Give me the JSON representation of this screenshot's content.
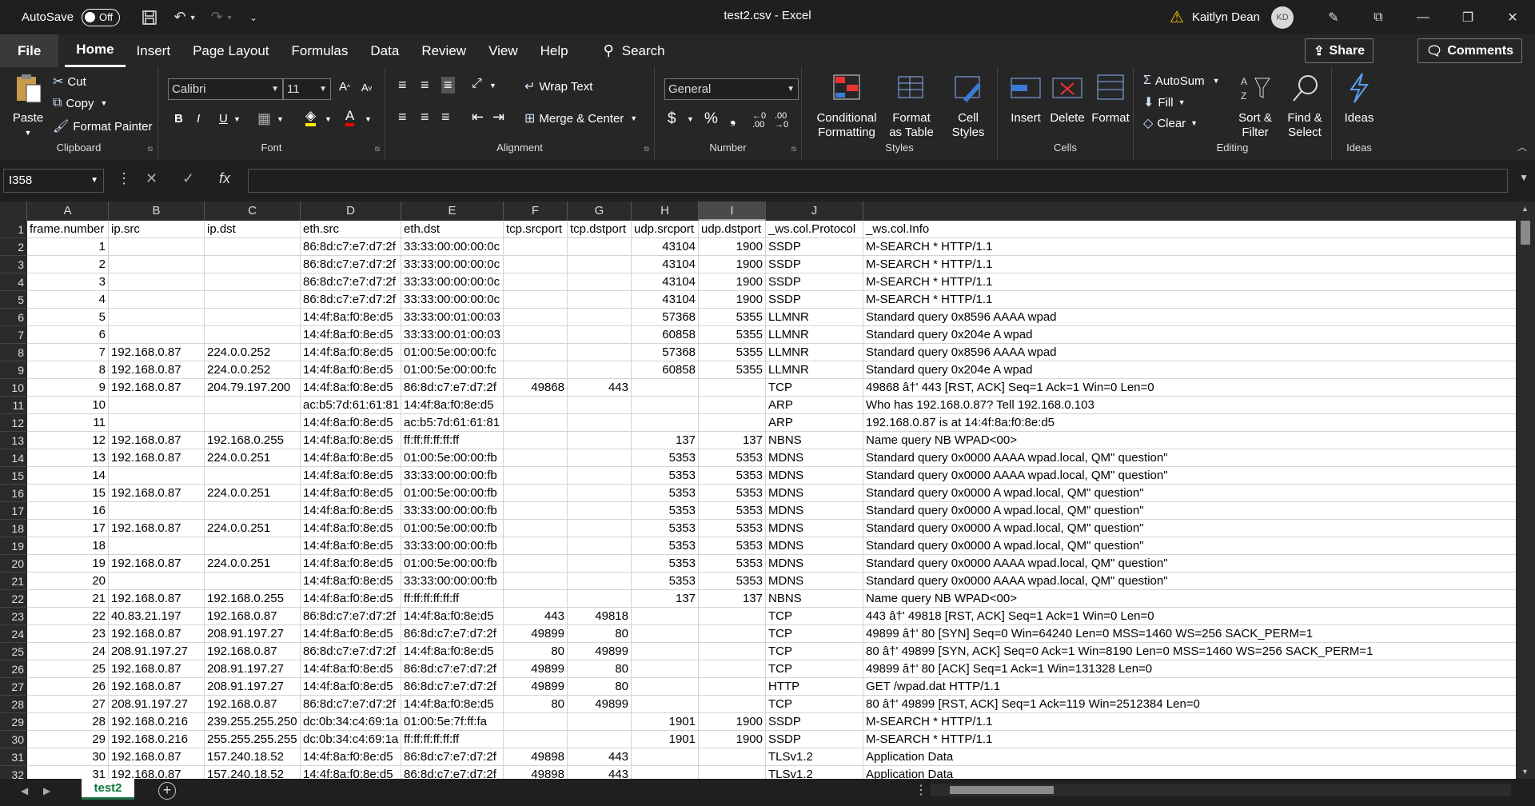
{
  "titlebar": {
    "autosave_label": "AutoSave",
    "autosave_state": "Off",
    "title": "test2.csv  -  Excel",
    "user_name": "Kaitlyn Dean",
    "user_initials": "KD"
  },
  "menu": {
    "file": "File",
    "tabs": [
      "Home",
      "Insert",
      "Page Layout",
      "Formulas",
      "Data",
      "Review",
      "View",
      "Help"
    ],
    "search": "Search",
    "share": "Share",
    "comments": "Comments"
  },
  "ribbon": {
    "clipboard": {
      "label": "Clipboard",
      "paste": "Paste",
      "cut": "Cut",
      "copy": "Copy",
      "format_painter": "Format Painter"
    },
    "font": {
      "label": "Font",
      "font_name": "Calibri",
      "font_size": "11",
      "bold": "B",
      "italic": "I",
      "underline": "U"
    },
    "alignment": {
      "label": "Alignment",
      "wrap_text": "Wrap Text",
      "merge_center": "Merge & Center"
    },
    "number": {
      "label": "Number",
      "format": "General",
      "currency": "$",
      "percent": "%"
    },
    "styles": {
      "label": "Styles",
      "conditional": "Conditional Formatting",
      "format_table": "Format as Table",
      "cell_styles": "Cell Styles"
    },
    "cells": {
      "label": "Cells",
      "insert": "Insert",
      "delete": "Delete",
      "format": "Format"
    },
    "editing": {
      "label": "Editing",
      "autosum": "AutoSum",
      "fill": "Fill",
      "clear": "Clear",
      "sort_filter": "Sort & Filter",
      "find_select": "Find & Select"
    },
    "ideas": {
      "label": "Ideas",
      "ideas": "Ideas"
    }
  },
  "formula_bar": {
    "name_box": "I358",
    "fx": "fx",
    "value": ""
  },
  "columns": [
    "A",
    "B",
    "C",
    "D",
    "E",
    "F",
    "G",
    "H",
    "I",
    "J"
  ],
  "selected_column": "I",
  "rows": [
    {
      "n": "1",
      "c": [
        "frame.number",
        "ip.src",
        "ip.dst",
        "eth.src",
        "eth.dst",
        "tcp.srcport",
        "tcp.dstport",
        "udp.srcport",
        "udp.dstport",
        "_ws.col.Protocol",
        "_ws.col.Info"
      ]
    },
    {
      "n": "2",
      "c": [
        "1",
        "",
        "",
        "86:8d:c7:e7:d7:2f",
        "33:33:00:00:00:0c",
        "",
        "",
        "43104",
        "1900",
        "SSDP",
        "M-SEARCH * HTTP/1.1"
      ]
    },
    {
      "n": "3",
      "c": [
        "2",
        "",
        "",
        "86:8d:c7:e7:d7:2f",
        "33:33:00:00:00:0c",
        "",
        "",
        "43104",
        "1900",
        "SSDP",
        "M-SEARCH * HTTP/1.1"
      ]
    },
    {
      "n": "4",
      "c": [
        "3",
        "",
        "",
        "86:8d:c7:e7:d7:2f",
        "33:33:00:00:00:0c",
        "",
        "",
        "43104",
        "1900",
        "SSDP",
        "M-SEARCH * HTTP/1.1"
      ]
    },
    {
      "n": "5",
      "c": [
        "4",
        "",
        "",
        "86:8d:c7:e7:d7:2f",
        "33:33:00:00:00:0c",
        "",
        "",
        "43104",
        "1900",
        "SSDP",
        "M-SEARCH * HTTP/1.1"
      ]
    },
    {
      "n": "6",
      "c": [
        "5",
        "",
        "",
        "14:4f:8a:f0:8e:d5",
        "33:33:00:01:00:03",
        "",
        "",
        "57368",
        "5355",
        "LLMNR",
        "Standard query 0x8596 AAAA wpad"
      ]
    },
    {
      "n": "7",
      "c": [
        "6",
        "",
        "",
        "14:4f:8a:f0:8e:d5",
        "33:33:00:01:00:03",
        "",
        "",
        "60858",
        "5355",
        "LLMNR",
        "Standard query 0x204e A wpad"
      ]
    },
    {
      "n": "8",
      "c": [
        "7",
        "192.168.0.87",
        "224.0.0.252",
        "14:4f:8a:f0:8e:d5",
        "01:00:5e:00:00:fc",
        "",
        "",
        "57368",
        "5355",
        "LLMNR",
        "Standard query 0x8596 AAAA wpad"
      ]
    },
    {
      "n": "9",
      "c": [
        "8",
        "192.168.0.87",
        "224.0.0.252",
        "14:4f:8a:f0:8e:d5",
        "01:00:5e:00:00:fc",
        "",
        "",
        "60858",
        "5355",
        "LLMNR",
        "Standard query 0x204e A wpad"
      ]
    },
    {
      "n": "10",
      "c": [
        "9",
        "192.168.0.87",
        "204.79.197.200",
        "14:4f:8a:f0:8e:d5",
        "86:8d:c7:e7:d7:2f",
        "49868",
        "443",
        "",
        "",
        "TCP",
        "49868 â†' 443 [RST, ACK] Seq=1 Ack=1 Win=0 Len=0"
      ]
    },
    {
      "n": "11",
      "c": [
        "10",
        "",
        "",
        "ac:b5:7d:61:61:81",
        "14:4f:8a:f0:8e:d5",
        "",
        "",
        "",
        "",
        "ARP",
        "Who has 192.168.0.87? Tell 192.168.0.103"
      ]
    },
    {
      "n": "12",
      "c": [
        "11",
        "",
        "",
        "14:4f:8a:f0:8e:d5",
        "ac:b5:7d:61:61:81",
        "",
        "",
        "",
        "",
        "ARP",
        "192.168.0.87 is at 14:4f:8a:f0:8e:d5"
      ]
    },
    {
      "n": "13",
      "c": [
        "12",
        "192.168.0.87",
        "192.168.0.255",
        "14:4f:8a:f0:8e:d5",
        "ff:ff:ff:ff:ff:ff",
        "",
        "",
        "137",
        "137",
        "NBNS",
        "Name query NB WPAD<00>"
      ]
    },
    {
      "n": "14",
      "c": [
        "13",
        "192.168.0.87",
        "224.0.0.251",
        "14:4f:8a:f0:8e:d5",
        "01:00:5e:00:00:fb",
        "",
        "",
        "5353",
        "5353",
        "MDNS",
        "Standard query 0x0000 AAAA wpad.local, QM\" question\""
      ]
    },
    {
      "n": "15",
      "c": [
        "14",
        "",
        "",
        "14:4f:8a:f0:8e:d5",
        "33:33:00:00:00:fb",
        "",
        "",
        "5353",
        "5353",
        "MDNS",
        "Standard query 0x0000 AAAA wpad.local, QM\" question\""
      ]
    },
    {
      "n": "16",
      "c": [
        "15",
        "192.168.0.87",
        "224.0.0.251",
        "14:4f:8a:f0:8e:d5",
        "01:00:5e:00:00:fb",
        "",
        "",
        "5353",
        "5353",
        "MDNS",
        "Standard query 0x0000 A wpad.local, QM\" question\""
      ]
    },
    {
      "n": "17",
      "c": [
        "16",
        "",
        "",
        "14:4f:8a:f0:8e:d5",
        "33:33:00:00:00:fb",
        "",
        "",
        "5353",
        "5353",
        "MDNS",
        "Standard query 0x0000 A wpad.local, QM\" question\""
      ]
    },
    {
      "n": "18",
      "c": [
        "17",
        "192.168.0.87",
        "224.0.0.251",
        "14:4f:8a:f0:8e:d5",
        "01:00:5e:00:00:fb",
        "",
        "",
        "5353",
        "5353",
        "MDNS",
        "Standard query 0x0000 A wpad.local, QM\" question\""
      ]
    },
    {
      "n": "19",
      "c": [
        "18",
        "",
        "",
        "14:4f:8a:f0:8e:d5",
        "33:33:00:00:00:fb",
        "",
        "",
        "5353",
        "5353",
        "MDNS",
        "Standard query 0x0000 A wpad.local, QM\" question\""
      ]
    },
    {
      "n": "20",
      "c": [
        "19",
        "192.168.0.87",
        "224.0.0.251",
        "14:4f:8a:f0:8e:d5",
        "01:00:5e:00:00:fb",
        "",
        "",
        "5353",
        "5353",
        "MDNS",
        "Standard query 0x0000 AAAA wpad.local, QM\" question\""
      ]
    },
    {
      "n": "21",
      "c": [
        "20",
        "",
        "",
        "14:4f:8a:f0:8e:d5",
        "33:33:00:00:00:fb",
        "",
        "",
        "5353",
        "5353",
        "MDNS",
        "Standard query 0x0000 AAAA wpad.local, QM\" question\""
      ]
    },
    {
      "n": "22",
      "c": [
        "21",
        "192.168.0.87",
        "192.168.0.255",
        "14:4f:8a:f0:8e:d5",
        "ff:ff:ff:ff:ff:ff",
        "",
        "",
        "137",
        "137",
        "NBNS",
        "Name query NB WPAD<00>"
      ]
    },
    {
      "n": "23",
      "c": [
        "22",
        "40.83.21.197",
        "192.168.0.87",
        "86:8d:c7:e7:d7:2f",
        "14:4f:8a:f0:8e:d5",
        "443",
        "49818",
        "",
        "",
        "TCP",
        "443 â†' 49818 [RST, ACK] Seq=1 Ack=1 Win=0 Len=0"
      ]
    },
    {
      "n": "24",
      "c": [
        "23",
        "192.168.0.87",
        "208.91.197.27",
        "14:4f:8a:f0:8e:d5",
        "86:8d:c7:e7:d7:2f",
        "49899",
        "80",
        "",
        "",
        "TCP",
        "49899 â†' 80 [SYN] Seq=0 Win=64240 Len=0 MSS=1460 WS=256 SACK_PERM=1"
      ]
    },
    {
      "n": "25",
      "c": [
        "24",
        "208.91.197.27",
        "192.168.0.87",
        "86:8d:c7:e7:d7:2f",
        "14:4f:8a:f0:8e:d5",
        "80",
        "49899",
        "",
        "",
        "TCP",
        "80 â†' 49899 [SYN, ACK] Seq=0 Ack=1 Win=8190 Len=0 MSS=1460 WS=256 SACK_PERM=1"
      ]
    },
    {
      "n": "26",
      "c": [
        "25",
        "192.168.0.87",
        "208.91.197.27",
        "14:4f:8a:f0:8e:d5",
        "86:8d:c7:e7:d7:2f",
        "49899",
        "80",
        "",
        "",
        "TCP",
        "49899 â†' 80 [ACK] Seq=1 Ack=1 Win=131328 Len=0"
      ]
    },
    {
      "n": "27",
      "c": [
        "26",
        "192.168.0.87",
        "208.91.197.27",
        "14:4f:8a:f0:8e:d5",
        "86:8d:c7:e7:d7:2f",
        "49899",
        "80",
        "",
        "",
        "HTTP",
        "GET /wpad.dat HTTP/1.1"
      ]
    },
    {
      "n": "28",
      "c": [
        "27",
        "208.91.197.27",
        "192.168.0.87",
        "86:8d:c7:e7:d7:2f",
        "14:4f:8a:f0:8e:d5",
        "80",
        "49899",
        "",
        "",
        "TCP",
        "80 â†' 49899 [RST, ACK] Seq=1 Ack=119 Win=2512384 Len=0"
      ]
    },
    {
      "n": "29",
      "c": [
        "28",
        "192.168.0.216",
        "239.255.255.250",
        "dc:0b:34:c4:69:1a",
        "01:00:5e:7f:ff:fa",
        "",
        "",
        "1901",
        "1900",
        "SSDP",
        "M-SEARCH * HTTP/1.1"
      ]
    },
    {
      "n": "30",
      "c": [
        "29",
        "192.168.0.216",
        "255.255.255.255",
        "dc:0b:34:c4:69:1a",
        "ff:ff:ff:ff:ff:ff",
        "",
        "",
        "1901",
        "1900",
        "SSDP",
        "M-SEARCH * HTTP/1.1"
      ]
    },
    {
      "n": "31",
      "c": [
        "30",
        "192.168.0.87",
        "157.240.18.52",
        "14:4f:8a:f0:8e:d5",
        "86:8d:c7:e7:d7:2f",
        "49898",
        "443",
        "",
        "",
        "TLSv1.2",
        "Application Data"
      ]
    },
    {
      "n": "32",
      "c": [
        "31",
        "192.168.0.87",
        "157.240.18.52",
        "14:4f:8a:f0:8e:d5",
        "86:8d:c7:e7:d7:2f",
        "49898",
        "443",
        "",
        "",
        "TLSv1.2",
        "Application Data"
      ]
    }
  ],
  "sheet_tab": "test2",
  "colors": {
    "accent": "#217346",
    "chrome": "#262626"
  }
}
